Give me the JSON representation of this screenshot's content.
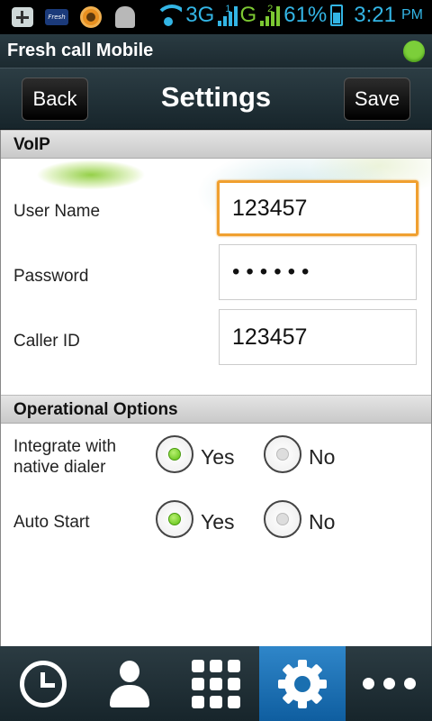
{
  "status_bar": {
    "network_3g": "3G",
    "network_g": "G",
    "sim1": "1",
    "sim2": "2",
    "battery_percent": "61%",
    "time": "3:21",
    "ampm": "PM",
    "icons": [
      "add-icon",
      "freshcall-icon",
      "ring-app-icon",
      "android-debug-icon",
      "wifi-icon",
      "signal-icon",
      "battery-icon"
    ]
  },
  "app_bar": {
    "title": "Fresh call Mobile",
    "status_color": "#7ccf3a"
  },
  "header": {
    "back_label": "Back",
    "title": "Settings",
    "save_label": "Save"
  },
  "voip": {
    "section_title": "VoIP",
    "fields": [
      {
        "label": "User Name",
        "value": "123457"
      },
      {
        "label": "Password",
        "value": "••••••"
      },
      {
        "label": "Caller ID",
        "value": "123457"
      }
    ]
  },
  "options": {
    "section_title": "Operational Options",
    "items": [
      {
        "label": "Integrate with native dialer",
        "line1": "Integrate with",
        "line2": "native dialer",
        "yes": "Yes",
        "no": "No",
        "selected": "Yes"
      },
      {
        "label": "Auto Start",
        "yes": "Yes",
        "no": "No",
        "selected": "Yes"
      }
    ]
  },
  "bottom_nav": {
    "items": [
      "history-icon",
      "contacts-icon",
      "dialpad-icon",
      "settings-icon",
      "more-icon"
    ],
    "active": "settings-icon",
    "accent": "#1a6fb0"
  }
}
